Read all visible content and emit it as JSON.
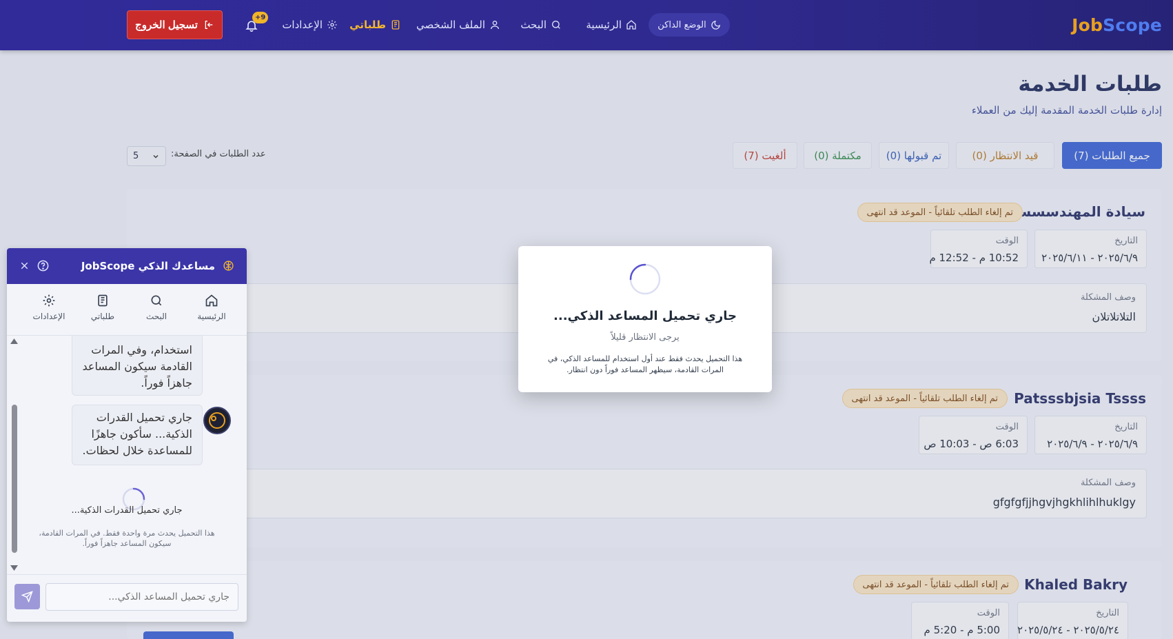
{
  "navbar": {
    "brand_part1": "Job",
    "brand_part2": "Scope",
    "dark_mode_label": "الوضع الداكن",
    "links": {
      "home": "الرئيسية",
      "search": "البحث",
      "profile": "الملف الشخصي",
      "my_requests": "طلباتي",
      "settings": "الإعدادات"
    },
    "notifications_badge": "+9",
    "logout_label": "تسجيل الخروج",
    "icons": [
      "moon-icon",
      "home-icon",
      "search-icon",
      "user-icon",
      "clipboard-icon",
      "gear-icon",
      "bell-icon",
      "logout-icon"
    ]
  },
  "page": {
    "title": "طلبات الخدمة",
    "subtitle": "إدارة طلبات الخدمة المقدمة إليك من العملاء",
    "filters": {
      "all": "جميع الطلبات (7)",
      "pending": "قيد الانتظار (0)",
      "accepted": "تم قبولها (0)",
      "completed": "مكتملة (0)",
      "cancelled": "ألغيت (7)"
    },
    "per_page_label": "عدد الطلبات في الصفحة:",
    "per_page_value": "5"
  },
  "requests": [
    {
      "client": "سيادة المهندسسسسس",
      "status": "تم إلغاء الطلب تلقائياً - الموعد قد انتهى",
      "date_label": "التاريخ",
      "date": "٢٠٢٥/٦/٩ - ٢٠٢٥/٦/١١",
      "time_label": "الوقت",
      "time": "10:52 م - 12:52 م",
      "desc_label": "وصف المشكلة",
      "desc": "التلاتلاتلان"
    },
    {
      "client": "Patsssbjsia Tssss",
      "status": "تم إلغاء الطلب تلقائياً - الموعد قد انتهى",
      "date_label": "التاريخ",
      "date": "٢٠٢٥/٦/٩ - ٢٠٢٥/٦/٩",
      "time_label": "الوقت",
      "time": "6:03 ص - 10:03 ص",
      "desc_label": "وصف المشكلة",
      "desc": "gfgfgfjjhgvjhgkhlihlhuklgy"
    },
    {
      "client": "Khaled Bakry",
      "status": "تم إلغاء الطلب تلقائياً - الموعد قد انتهى",
      "date_label": "التاريخ",
      "date": "٢٠٢٥/٥/٢٤ - ٢٠٢٥/٥/٢٤",
      "time_label": "الوقت",
      "time": "5:00 م - 5:20 م"
    }
  ],
  "chat": {
    "title": "مساعدك الذكي JobScope",
    "nav": {
      "home": "الرئيسية",
      "search": "البحث",
      "my_requests": "طلباتي",
      "settings": "الإعدادات"
    },
    "message_1": "استخدام، وفي المرات القادمة سيكون المساعد جاهزاً فوراً.",
    "message_2": "جاري تحميل القدرات الذكية... سأكون جاهزًا للمساعدة خلال لحظات.",
    "loading_title": "جاري تحميل القدرات الذكية...",
    "loading_note": "هذا التحميل يحدث مرة واحدة فقط. في المرات القادمة، سيكون المساعد جاهزاً فوراً.",
    "input_placeholder": "جاري تحميل المساعد الذكي..."
  },
  "modal": {
    "title": "جاري تحميل المساعد الذكي...",
    "subtitle": "يرجى الانتظار قليلاً",
    "note": "هذا التحميل يحدث فقط عند أول استخدام للمساعد الذكي، في المرات القادمة، سيظهر المساعد فوراً دون انتظار."
  },
  "colors": {
    "navbar": "#312b9a",
    "accent": "#f2b530",
    "primary": "#3a63d6",
    "danger": "#c92a2a",
    "badge": "#fbe7c6"
  }
}
